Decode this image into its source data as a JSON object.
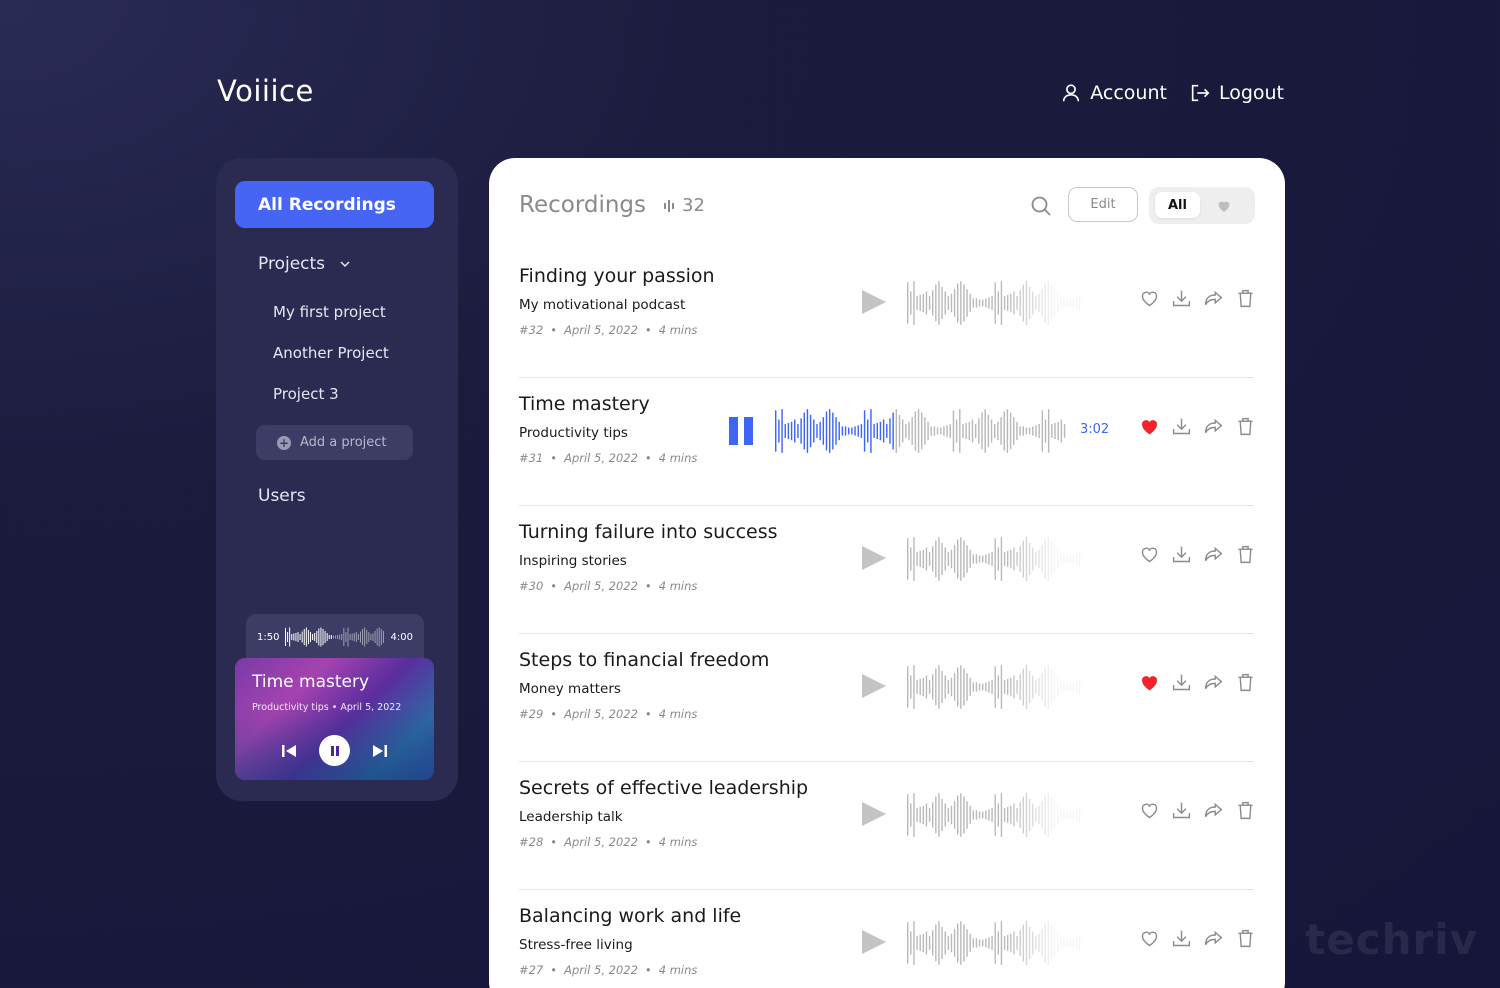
{
  "app": {
    "logo": "Voiiice"
  },
  "topnav": {
    "account_label": "Account",
    "logout_label": "Logout"
  },
  "sidebar": {
    "all_recordings_label": "All Recordings",
    "projects_label": "Projects",
    "project_items": [
      "My first project",
      "Another Project",
      "Project 3"
    ],
    "add_project_label": "Add a project",
    "users_label": "Users"
  },
  "mini_player": {
    "elapsed": "1:50",
    "duration": "4:00",
    "title": "Time mastery",
    "subtitle": "Productivity tips",
    "date": "April 5, 2022"
  },
  "main": {
    "title": "Recordings",
    "count": "32",
    "edit_label": "Edit",
    "filter_all_label": "All"
  },
  "recordings": [
    {
      "title": "Finding your passion",
      "project": "My motivational podcast",
      "id": "#32",
      "date": "April 5, 2022",
      "length": "4 mins",
      "favorite": false,
      "playing": false
    },
    {
      "title": "Time mastery",
      "project": "Productivity tips",
      "id": "#31",
      "date": "April 5, 2022",
      "length": "4 mins",
      "favorite": true,
      "playing": true,
      "time": "3:02"
    },
    {
      "title": "Turning failure into success",
      "project": "Inspiring stories",
      "id": "#30",
      "date": "April 5, 2022",
      "length": "4 mins",
      "favorite": false,
      "playing": false
    },
    {
      "title": "Steps to financial freedom",
      "project": "Money matters",
      "id": "#29",
      "date": "April 5, 2022",
      "length": "4 mins",
      "favorite": true,
      "playing": false
    },
    {
      "title": "Secrets of effective leadership",
      "project": "Leadership talk",
      "id": "#28",
      "date": "April 5, 2022",
      "length": "4 mins",
      "favorite": false,
      "playing": false
    },
    {
      "title": "Balancing work and life",
      "project": "Stress-free living",
      "id": "#27",
      "date": "April 5, 2022",
      "length": "4 mins",
      "favorite": false,
      "playing": false
    }
  ],
  "colors": {
    "accent": "#4765f5",
    "favorite": "#f0222d",
    "sidebar_bg": "#2b2b52"
  },
  "watermark": "techriv"
}
